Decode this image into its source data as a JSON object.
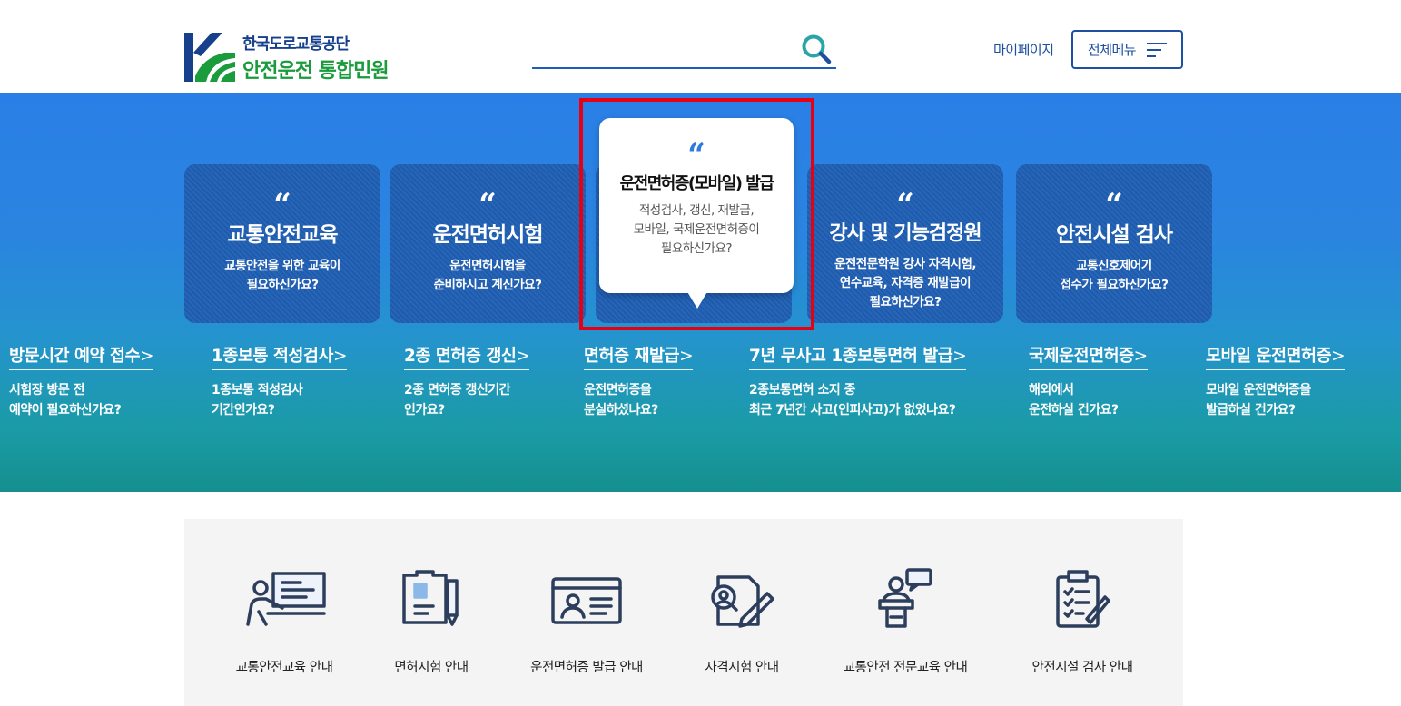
{
  "header": {
    "logo_org": "한국도로교통공단",
    "logo_service": "안전운전 통합민원",
    "search_placeholder": "",
    "mypage": "마이페이지",
    "all_menu": "전체메뉴"
  },
  "cards": [
    {
      "quote": "“",
      "title": "교통안전교육",
      "desc1": "교통안전을 위한 교육이",
      "desc2": "필요하신가요?",
      "desc3": ""
    },
    {
      "quote": "“",
      "title": "운전면허시험",
      "desc1": "운전면허시험을",
      "desc2": "준비하시고 계신가요?",
      "desc3": ""
    },
    {
      "quote": "“",
      "title": "운전면허증(모바일) 발급",
      "desc1": "적성검사, 갱신, 재발급,",
      "desc2": "모바일, 국제운전면허증이",
      "desc3": "필요하신가요?"
    },
    {
      "quote": "“",
      "title": "강사 및 기능검정원",
      "desc1": "운전전문학원 강사 자격시험,",
      "desc2": "연수교육, 자격증 재발급이",
      "desc3": "필요하신가요?"
    },
    {
      "quote": "“",
      "title": "안전시설 검사",
      "desc1": "교통신호제어기",
      "desc2": "접수가 필요하신가요?",
      "desc3": ""
    }
  ],
  "quick_links": [
    {
      "title": "방문시간 예약 접수",
      "arrow": ">",
      "desc1": "시험장 방문 전",
      "desc2": "예약이 필요하신가요?"
    },
    {
      "title": "1종보통 적성검사",
      "arrow": ">",
      "desc1": "1종보통 적성검사",
      "desc2": "기간인가요?"
    },
    {
      "title": "2종 면허증 갱신",
      "arrow": ">",
      "desc1": "2종 면허증 갱신기간",
      "desc2": "인가요?"
    },
    {
      "title": "면허증 재발급",
      "arrow": ">",
      "desc1": "운전면허증을",
      "desc2": "분실하셨나요?"
    },
    {
      "title": "7년 무사고 1종보통면허 발급",
      "arrow": ">",
      "desc1": "2종보통면허 소지 중",
      "desc2": "최근 7년간 사고(인피사고)가 없었나요?"
    },
    {
      "title": "국제운전면허증",
      "arrow": ">",
      "desc1": "해외에서",
      "desc2": "운전하실 건가요?"
    },
    {
      "title": "모바일 운전면허증",
      "arrow": ">",
      "desc1": "모바일 운전면허증을",
      "desc2": "발급하실 건가요?"
    }
  ],
  "guides": [
    {
      "label": "교통안전교육 안내",
      "icon": "lecture-icon"
    },
    {
      "label": "면허시험 안내",
      "icon": "license-exam-icon"
    },
    {
      "label": "운전면허증 발급 안내",
      "icon": "id-card-icon"
    },
    {
      "label": "자격시험 안내",
      "icon": "qualification-icon"
    },
    {
      "label": "교통안전 전문교육 안내",
      "icon": "speaker-icon"
    },
    {
      "label": "안전시설 검사 안내",
      "icon": "checklist-icon"
    }
  ],
  "colors": {
    "brand_blue": "#1f4fa0",
    "brand_green": "#1a9b3c",
    "highlight": "#e60012",
    "hero_top": "#2a7fe6",
    "hero_bottom": "#158f8e"
  }
}
